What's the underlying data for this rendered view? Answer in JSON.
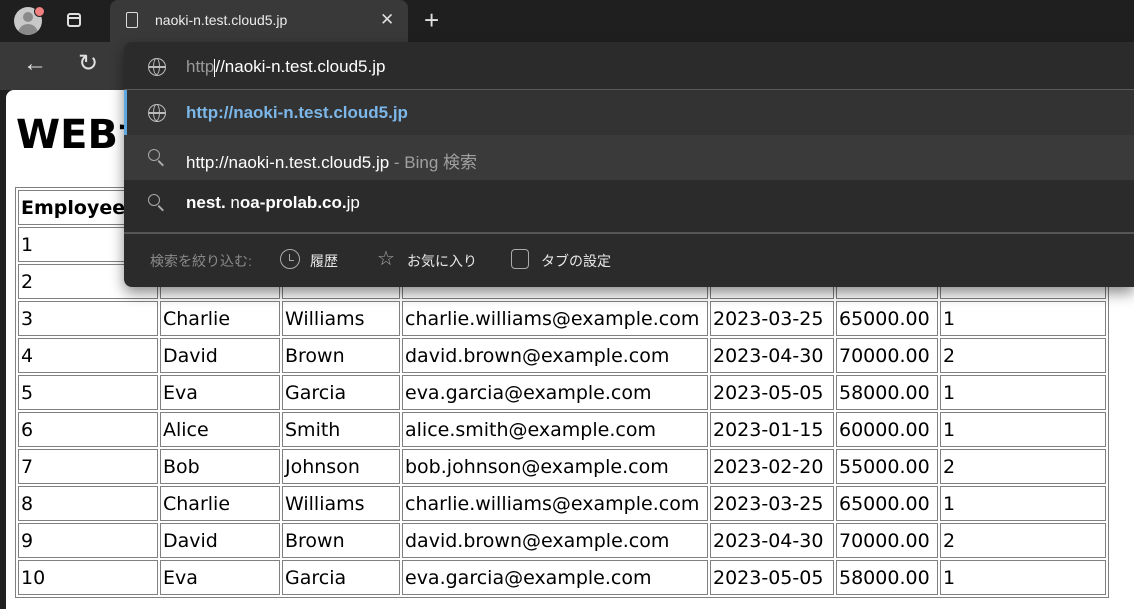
{
  "browser": {
    "tab": {
      "title": "naoki-n.test.cloud5.jp",
      "close_glyph": "✕"
    },
    "new_tab_glyph": "+",
    "nav": {
      "back_glyph": "←",
      "reload_glyph": "↻"
    },
    "address_bar": {
      "typed_prefix": "http",
      "typed_rest": "//naoki-n.test.cloud5.jp",
      "full_value": "http://naoki-n.test.cloud5.jp"
    },
    "suggestions": [
      {
        "type": "url",
        "icon": "globe-icon",
        "text": "http://naoki-n.test.cloud5.jp",
        "suffix": ""
      },
      {
        "type": "search",
        "icon": "search-icon",
        "text": "http://naoki-n.test.cloud5.jp",
        "suffix": " - Bing 検索"
      },
      {
        "type": "search",
        "icon": "search-icon",
        "bold_a": "nest.",
        "plain_a": " n",
        "bold_b": "oa-prolab.co.",
        "plain_b": "jp"
      }
    ],
    "filter": {
      "label": "検索を絞り込む:",
      "chips": [
        {
          "icon": "history-icon",
          "label": "履歴"
        },
        {
          "icon": "star-icon",
          "label": "お気に入り"
        },
        {
          "icon": "tabs-icon",
          "label": "タブの設定"
        }
      ]
    }
  },
  "page": {
    "heading": "WEBサ",
    "table": {
      "headers": [
        "Employee",
        "",
        "",
        "",
        "",
        "",
        ""
      ],
      "rows": [
        [
          "1",
          "",
          "",
          "",
          "",
          "",
          ""
        ],
        [
          "2",
          "",
          "",
          "",
          "",
          "",
          ""
        ],
        [
          "3",
          "Charlie",
          "Williams",
          "charlie.williams@example.com",
          "2023-03-25",
          "65000.00",
          "1"
        ],
        [
          "4",
          "David",
          "Brown",
          "david.brown@example.com",
          "2023-04-30",
          "70000.00",
          "2"
        ],
        [
          "5",
          "Eva",
          "Garcia",
          "eva.garcia@example.com",
          "2023-05-05",
          "58000.00",
          "1"
        ],
        [
          "6",
          "Alice",
          "Smith",
          "alice.smith@example.com",
          "2023-01-15",
          "60000.00",
          "1"
        ],
        [
          "7",
          "Bob",
          "Johnson",
          "bob.johnson@example.com",
          "2023-02-20",
          "55000.00",
          "2"
        ],
        [
          "8",
          "Charlie",
          "Williams",
          "charlie.williams@example.com",
          "2023-03-25",
          "65000.00",
          "1"
        ],
        [
          "9",
          "David",
          "Brown",
          "david.brown@example.com",
          "2023-04-30",
          "70000.00",
          "2"
        ],
        [
          "10",
          "Eva",
          "Garcia",
          "eva.garcia@example.com",
          "2023-05-05",
          "58000.00",
          "1"
        ]
      ]
    }
  },
  "colors": {
    "suggestion_accent": "#5fa8e0",
    "url_suggestion_text": "#7cb7ea"
  }
}
